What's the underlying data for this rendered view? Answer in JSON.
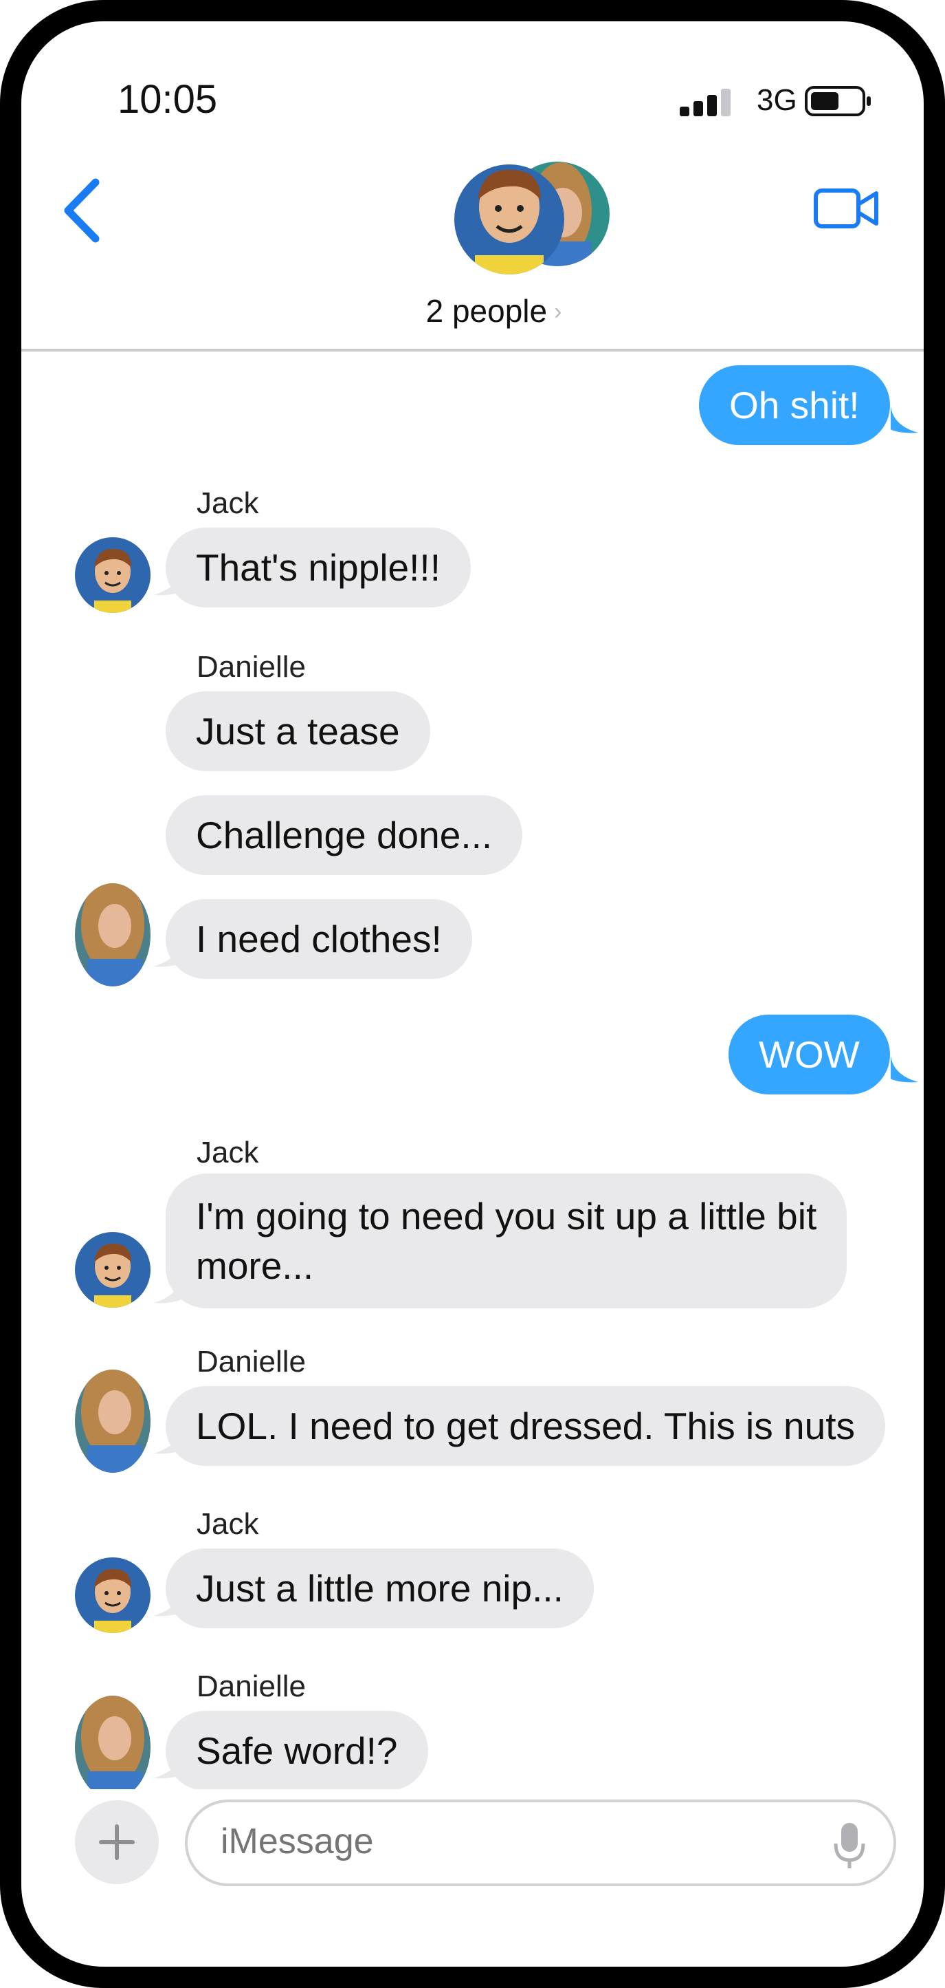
{
  "status_bar": {
    "time": "10:05",
    "network": "3G"
  },
  "header": {
    "participants_label": "2 people",
    "chevron": "›"
  },
  "messages": [
    {
      "type": "outgoing",
      "text": "Oh shit!"
    },
    {
      "type": "incoming",
      "sender": "Jack",
      "text": "That's nipple!!!"
    },
    {
      "type": "incoming",
      "sender": "Danielle",
      "text": "Just a tease"
    },
    {
      "type": "incoming",
      "text": "Challenge done..."
    },
    {
      "type": "incoming",
      "text": "I need clothes!"
    },
    {
      "type": "outgoing",
      "text": "WOW"
    },
    {
      "type": "incoming",
      "sender": "Jack",
      "text_line1": "I'm going to need you sit up a little bit",
      "text_line2": "more..."
    },
    {
      "type": "incoming",
      "sender": "Danielle",
      "text": "LOL.  I need to get dressed.  This is nuts"
    },
    {
      "type": "incoming",
      "sender": "Jack",
      "text": "Just a little more nip..."
    },
    {
      "type": "incoming",
      "sender": "Danielle",
      "text": "Safe word!?"
    }
  ],
  "composer": {
    "placeholder": "iMessage",
    "plus_icon": "plus-icon",
    "mic_icon": "microphone-icon"
  },
  "colors": {
    "accent": "#1a7cf5",
    "outgoing_bubble": "#34a6ff",
    "incoming_bubble": "#e9e9eb"
  }
}
